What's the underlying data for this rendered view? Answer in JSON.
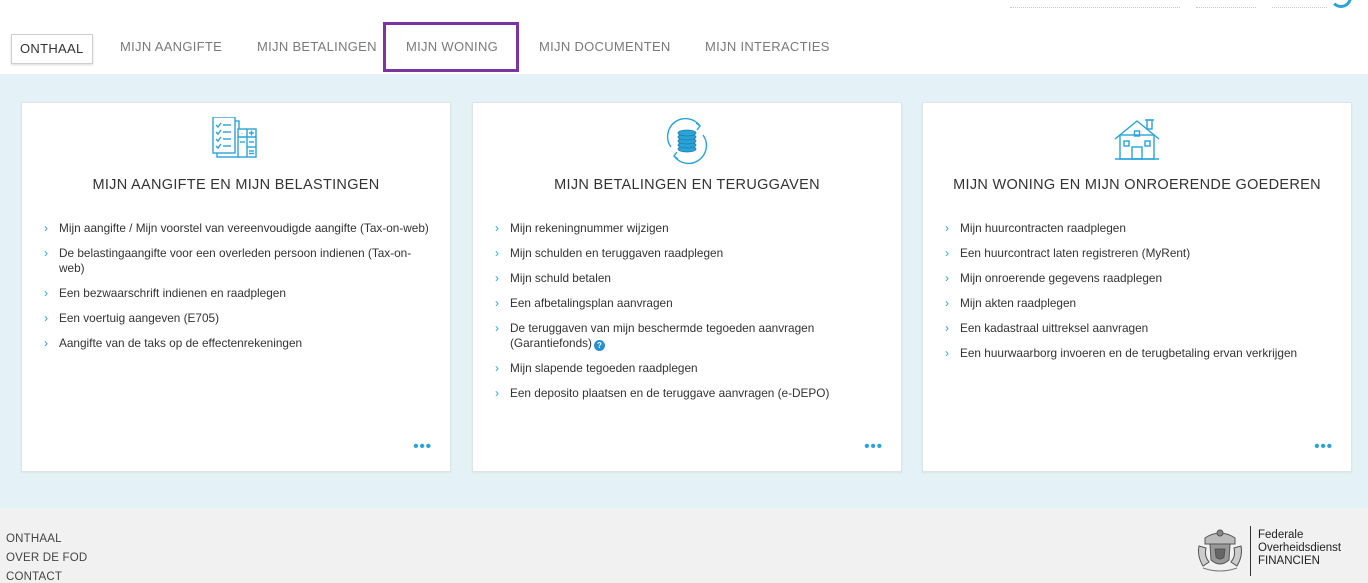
{
  "nav": {
    "tabs": [
      {
        "label": "ONTHAAL"
      },
      {
        "label": "MIJN AANGIFTE"
      },
      {
        "label": "MIJN BETALINGEN"
      },
      {
        "label": "MIJN WONING"
      },
      {
        "label": "MIJN DOCUMENTEN"
      },
      {
        "label": "MIJN INTERACTIES"
      }
    ],
    "active_tab": "ONTHAAL",
    "highlighted_tab": "MIJN WONING"
  },
  "cards": [
    {
      "icon": "tax-form-icon",
      "title": "MIJN AANGIFTE EN MIJN BELASTINGEN",
      "items": [
        "Mijn aangifte / Mijn voorstel van vereenvoudigde aangifte (Tax-on-web)",
        "De belastingaangifte voor een overleden persoon indienen (Tax-on-web)",
        "Een bezwaarschrift indienen en raadplegen",
        "Een voertuig aangeven (E705)",
        "Aangifte van de taks op de effectenrekeningen"
      ],
      "more": "•••"
    },
    {
      "icon": "coins-refresh-icon",
      "title": "MIJN BETALINGEN EN TERUGGAVEN",
      "items": [
        "Mijn rekeningnummer wijzigen",
        "Mijn schulden en teruggaven raadplegen",
        "Mijn schuld betalen",
        "Een afbetalingsplan aanvragen",
        "De teruggaven van mijn beschermde tegoeden aanvragen (Garantiefonds)",
        "Mijn slapende tegoeden raadplegen",
        "Een deposito plaatsen en de teruggave aanvragen (e-DEPO)"
      ],
      "more": "•••"
    },
    {
      "icon": "house-icon",
      "title": "MIJN WONING EN MIJN ONROERENDE GOEDEREN",
      "items": [
        "Mijn huurcontracten raadplegen",
        "Een huurcontract laten registreren (MyRent)",
        "Mijn onroerende gegevens raadplegen",
        "Mijn akten raadplegen",
        "Een kadastraal uittreksel aanvragen",
        "Een huurwaarborg invoeren en de terugbetaling ervan verkrijgen"
      ],
      "more": "•••"
    }
  ],
  "footer": {
    "links": [
      "ONTHAAL",
      "OVER DE FOD",
      "CONTACT"
    ],
    "org": {
      "line1": "Federale",
      "line2": "Overheidsdienst",
      "line3": "FINANCIEN"
    }
  },
  "colors": {
    "accent": "#2aa3d8",
    "highlight_border": "#7b35a0",
    "main_bg": "#e4f2f7",
    "footer_bg": "#f1f1f1"
  }
}
